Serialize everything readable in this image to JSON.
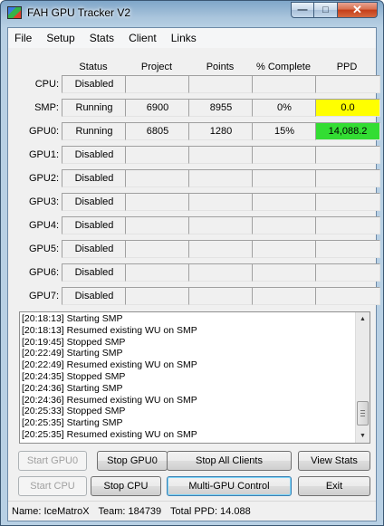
{
  "window": {
    "title": "FAH GPU Tracker V2",
    "caption_buttons": {
      "minimize": "—",
      "maximize": "□",
      "close": "✕"
    }
  },
  "menu": [
    "File",
    "Setup",
    "Stats",
    "Client",
    "Links"
  ],
  "table": {
    "headers": [
      "Status",
      "Project",
      "Points",
      "% Complete",
      "PPD"
    ],
    "rows": [
      {
        "label": "CPU:",
        "status": "Disabled",
        "project": "",
        "points": "",
        "complete": "",
        "ppd": "",
        "ppd_color": ""
      },
      {
        "label": "SMP:",
        "status": "Running",
        "project": "6900",
        "points": "8955",
        "complete": "0%",
        "ppd": "0.0",
        "ppd_color": "#ffff00"
      },
      {
        "label": "GPU0:",
        "status": "Running",
        "project": "6805",
        "points": "1280",
        "complete": "15%",
        "ppd": "14,088.2",
        "ppd_color": "#33dd33"
      },
      {
        "label": "GPU1:",
        "status": "Disabled",
        "project": "",
        "points": "",
        "complete": "",
        "ppd": "",
        "ppd_color": ""
      },
      {
        "label": "GPU2:",
        "status": "Disabled",
        "project": "",
        "points": "",
        "complete": "",
        "ppd": "",
        "ppd_color": ""
      },
      {
        "label": "GPU3:",
        "status": "Disabled",
        "project": "",
        "points": "",
        "complete": "",
        "ppd": "",
        "ppd_color": ""
      },
      {
        "label": "GPU4:",
        "status": "Disabled",
        "project": "",
        "points": "",
        "complete": "",
        "ppd": "",
        "ppd_color": ""
      },
      {
        "label": "GPU5:",
        "status": "Disabled",
        "project": "",
        "points": "",
        "complete": "",
        "ppd": "",
        "ppd_color": ""
      },
      {
        "label": "GPU6:",
        "status": "Disabled",
        "project": "",
        "points": "",
        "complete": "",
        "ppd": "",
        "ppd_color": ""
      },
      {
        "label": "GPU7:",
        "status": "Disabled",
        "project": "",
        "points": "",
        "complete": "",
        "ppd": "",
        "ppd_color": ""
      }
    ]
  },
  "log": [
    "[20:18:13] Starting SMP",
    "[20:18:13] Resumed existing WU on SMP",
    "[20:19:45] Stopped SMP",
    "[20:22:49] Starting SMP",
    "[20:22:49] Resumed existing WU on SMP",
    "[20:24:35] Stopped SMP",
    "[20:24:36] Starting SMP",
    "[20:24:36] Resumed existing WU on SMP",
    "[20:25:33] Stopped SMP",
    "[20:25:35] Starting SMP",
    "[20:25:35] Resumed existing WU on SMP"
  ],
  "buttons": {
    "start_gpu0": "Start GPU0",
    "stop_gpu0": "Stop GPU0",
    "stop_all": "Stop All Clients",
    "view_stats": "View Stats",
    "start_cpu": "Start CPU",
    "stop_cpu": "Stop CPU",
    "multi_gpu": "Multi-GPU Control",
    "exit": "Exit"
  },
  "status": {
    "name": "Name: IceMatroX",
    "team": "Team: 184739",
    "total_ppd": "Total PPD: 14.088"
  }
}
